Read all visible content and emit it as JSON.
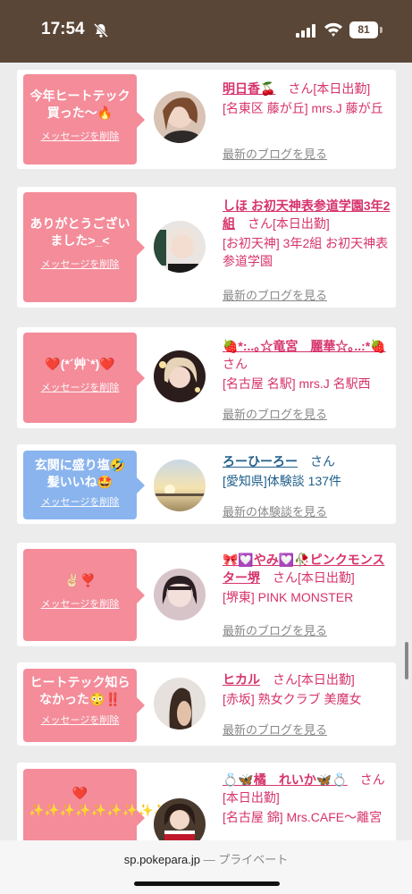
{
  "status": {
    "time": "17:54",
    "battery": "81"
  },
  "cards": [
    {
      "color": "pink",
      "message": "今年ヒートテック買った〜🔥",
      "delete_label": "メッセージを削除",
      "name": "明日香🍒",
      "san": "　さん[本日出勤]",
      "location": "[名東区 藤が丘] mrs.J 藤が丘",
      "blog_link": "最新のブログを見る"
    },
    {
      "color": "pink",
      "message": "ありがとうございました>_<",
      "delete_label": "メッセージを削除",
      "name": "しほ お初天神表参道学園3年2組",
      "san": "　さん[本日出勤]",
      "location": "[お初天神] 3年2組 お初天神表参道学園",
      "blog_link": "最新のブログを見る"
    },
    {
      "color": "pink",
      "message": "❤️(*´艸`*)❤️",
      "delete_label": "メッセージを削除",
      "name": "🍓*:..｡☆竜宮　麗華☆｡..:*🍓",
      "san": "　さん",
      "location": "[名古屋 名駅] mrs.J 名駅西",
      "blog_link": "最新のブログを見る"
    },
    {
      "color": "blue",
      "message": "玄関に盛り塩🤣髪いいね🤩",
      "delete_label": "メッセージを削除",
      "name": "ろーひーろー",
      "san": "　さん",
      "location": "[愛知県]体験談 137件",
      "blog_link": "最新の体験談を見る"
    },
    {
      "color": "pink",
      "message": "✌🏻❣️",
      "delete_label": "メッセージを削除",
      "name": "🎀💟やみ💟🥀ピンクモンスター堺",
      "san": "　さん[本日出勤]",
      "location": "[堺東] PINK MONSTER",
      "blog_link": "最新のブログを見る"
    },
    {
      "color": "pink",
      "message": "ヒートテック知らなかった😳‼️",
      "delete_label": "メッセージを削除",
      "name": "ヒカル",
      "san": "　さん[本日出勤]",
      "location": "[赤坂] 熟女クラブ 美魔女",
      "blog_link": "最新のブログを見る"
    },
    {
      "color": "pink",
      "message": "❤️ ✨✨✨✨✨✨✨✨✨✨",
      "delete_label": "メッセージを削除",
      "name": "💍🦋橘　れいか🦋💍",
      "san": "　さん[本日出勤]",
      "location": "[名古屋 錦] Mrs.CAFE〜離宮",
      "blog_link": ""
    }
  ],
  "url_bar": {
    "domain": "sp.pokepara.jp",
    "separator": " — ",
    "mode": "プライベート"
  }
}
